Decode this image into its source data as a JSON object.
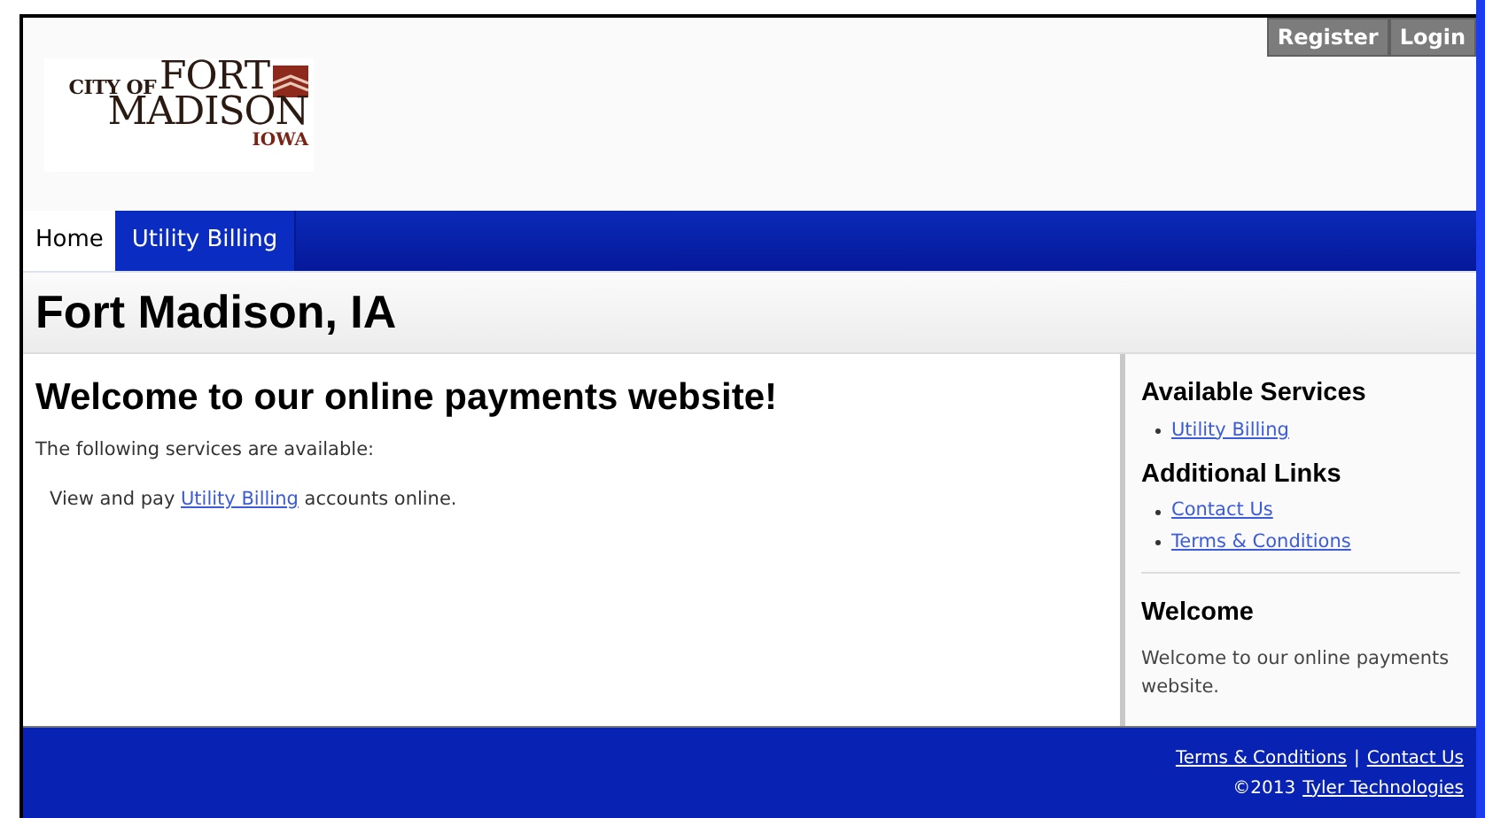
{
  "header": {
    "logo": {
      "line_1_small": "CITY OF",
      "line_1_large": "FORT",
      "line_2": "MADISON",
      "line_3": "IOWA"
    },
    "buttons": [
      {
        "label": "Register"
      },
      {
        "label": "Login"
      }
    ]
  },
  "nav": {
    "tabs": [
      {
        "label": "Home",
        "selected": true
      },
      {
        "label": "Utility Billing",
        "selected": false
      }
    ]
  },
  "page_title": "Fort Madison, IA",
  "main": {
    "heading": "Welcome to our online payments website!",
    "intro": "The following services are available:",
    "service_line": {
      "before": "View and pay",
      "link": "Utility Billing",
      "after": "accounts online."
    }
  },
  "sidebar": {
    "sections": [
      {
        "heading": "Available Services",
        "links": [
          "Utility Billing"
        ]
      },
      {
        "heading": "Additional Links",
        "links": [
          "Contact Us",
          "Terms & Conditions"
        ]
      }
    ],
    "welcome": {
      "heading": "Welcome",
      "text": "Welcome to our online payments website."
    }
  },
  "footer": {
    "links": [
      "Terms & Conditions",
      "Contact Us"
    ],
    "separator": "|",
    "copyright": "©2013",
    "company_link": "Tyler Technologies"
  }
}
